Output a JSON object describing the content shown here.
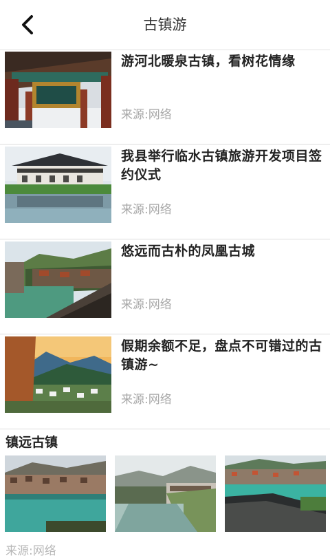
{
  "header": {
    "title": "古镇游",
    "back_icon": "chevron-left-icon"
  },
  "articles": [
    {
      "title": "游河北暖泉古镇，看树花情缘",
      "source": "来源:网络",
      "image": "ancient-gate-photo"
    },
    {
      "title": "我县举行临水古镇旅游开发项目签约仪式",
      "source": "来源:网络",
      "image": "riverside-house-photo"
    },
    {
      "title": "悠远而古朴的凤凰古城",
      "source": "来源:网络",
      "image": "phoenix-town-photo"
    },
    {
      "title": "假期余额不足，盘点不可错过的古镇游~",
      "source": "来源:网络",
      "image": "mountain-village-photo"
    }
  ],
  "section": {
    "title": "镇远古镇"
  },
  "gallery": [
    {
      "image": "zhenyuan-town-photo-1"
    },
    {
      "image": "zhenyuan-river-photo-2"
    },
    {
      "image": "zhenyuan-river-photo-3"
    }
  ],
  "peek_text": "来源:网络"
}
